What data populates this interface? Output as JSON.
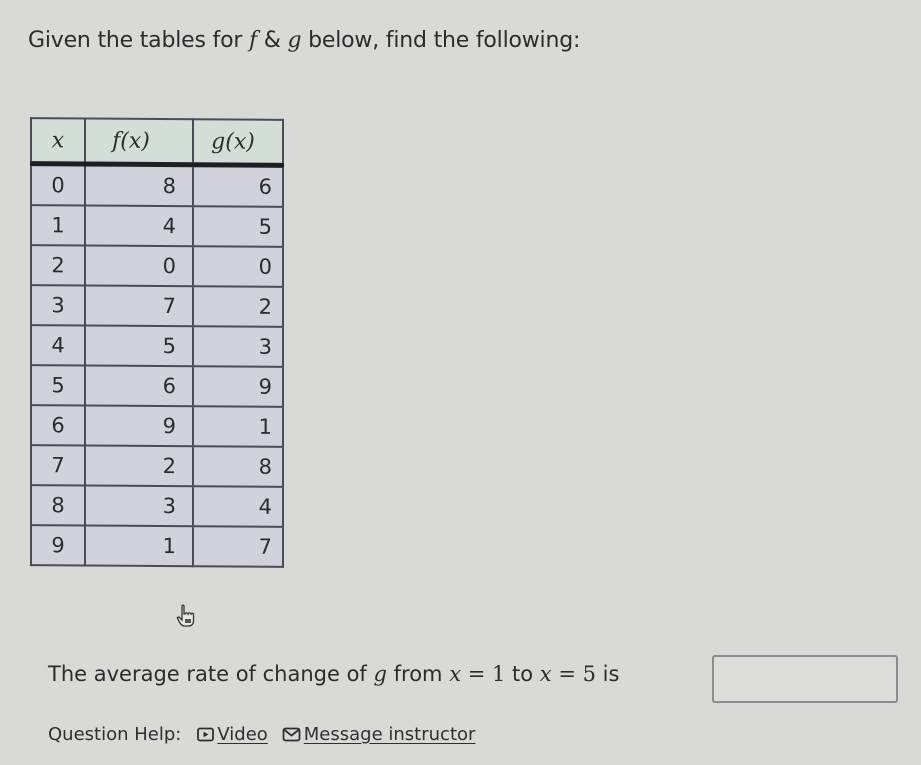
{
  "prompt": {
    "before": "Given the tables for ",
    "f": "f",
    "amp": " & ",
    "g": "g",
    "after": " below, find the following:"
  },
  "table": {
    "headers": [
      "x",
      "f(x)",
      "g(x)"
    ],
    "rows": [
      {
        "x": "0",
        "f": "8",
        "g": "6"
      },
      {
        "x": "1",
        "f": "4",
        "g": "5"
      },
      {
        "x": "2",
        "f": "0",
        "g": "0"
      },
      {
        "x": "3",
        "f": "7",
        "g": "2"
      },
      {
        "x": "4",
        "f": "5",
        "g": "3"
      },
      {
        "x": "5",
        "f": "6",
        "g": "9"
      },
      {
        "x": "6",
        "f": "9",
        "g": "1"
      },
      {
        "x": "7",
        "f": "2",
        "g": "8"
      },
      {
        "x": "8",
        "f": "3",
        "g": "4"
      },
      {
        "x": "9",
        "f": "1",
        "g": "7"
      }
    ]
  },
  "question": {
    "part1": "The average rate of change of ",
    "func": "g",
    "part2": " from ",
    "var1": "x",
    "eq1": " = ",
    "val1": "1",
    "to": " to ",
    "var2": "x",
    "eq2": " = ",
    "val2": "5",
    "is": " is ",
    "answer_value": ""
  },
  "help": {
    "label": "Question Help:",
    "video": "Video",
    "message": "Message instructor"
  },
  "icons": {
    "video": "play-box-icon",
    "message": "envelope-icon",
    "cursor": "hand-pointer-icon"
  }
}
